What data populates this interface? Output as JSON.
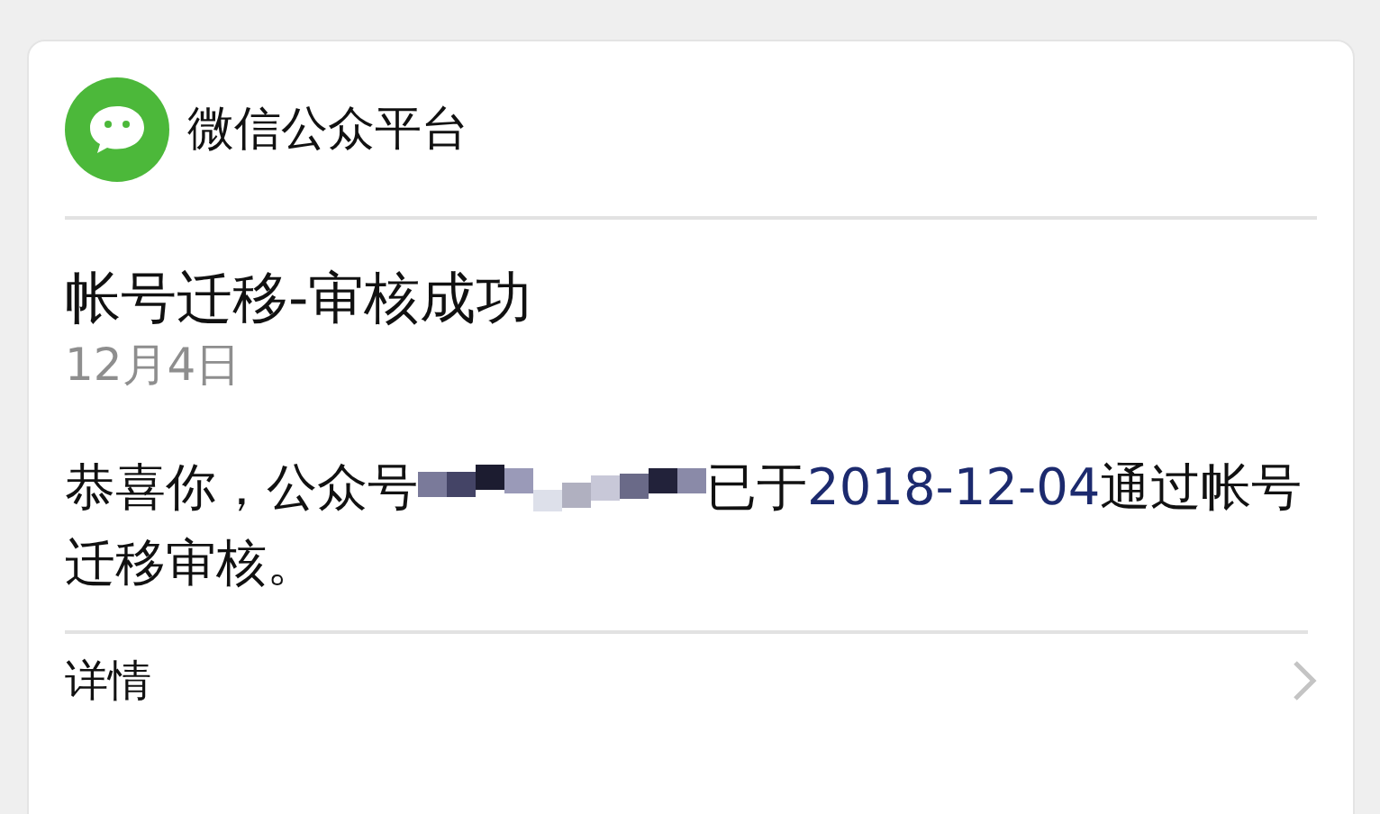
{
  "header": {
    "app_name": "微信公众平台"
  },
  "message": {
    "title": "帐号迁移-审核成功",
    "date": "12月4日",
    "text_before": "恭喜你，公众号",
    "redacted": true,
    "text_middle": "已于",
    "link": "2018-12-04",
    "text_after": "通过帐号迁移审核。"
  },
  "footer": {
    "label": "详情"
  }
}
